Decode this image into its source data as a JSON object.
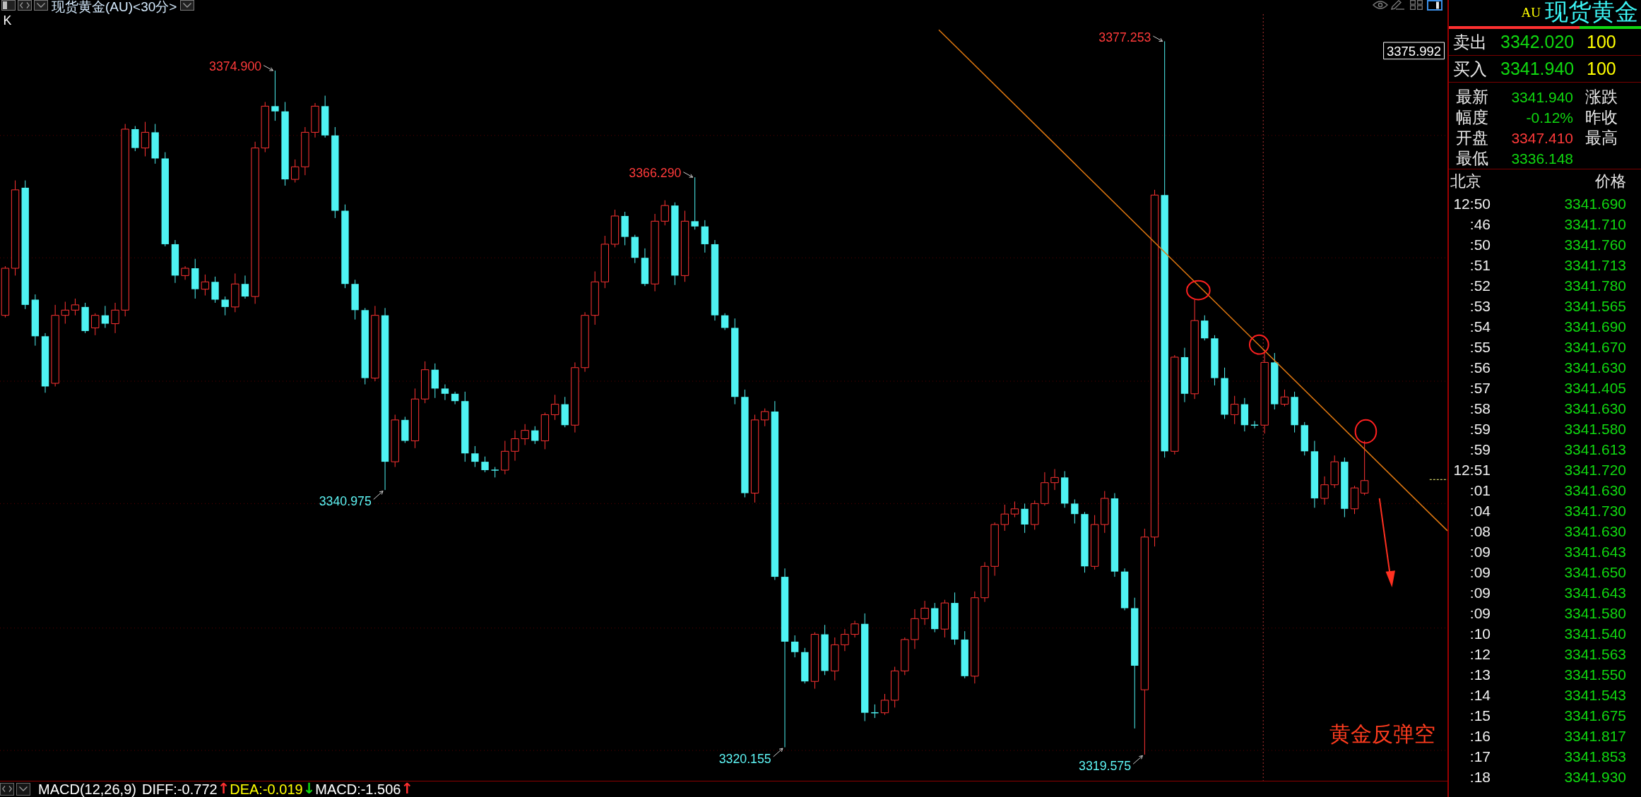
{
  "toolbar": {
    "title": "现货黄金(AU)<30分>"
  },
  "chart": {
    "label": "K",
    "price_tag": "3375.992",
    "annotations": [
      {
        "kind": "high",
        "text": "3377.253"
      },
      {
        "kind": "high",
        "text": "3374.900"
      },
      {
        "kind": "high",
        "text": "3366.290"
      },
      {
        "kind": "low",
        "text": "3340.975"
      },
      {
        "kind": "low",
        "text": "3320.155"
      },
      {
        "kind": "low",
        "text": "3319.575"
      }
    ],
    "note": "黄金反弹空"
  },
  "indicator_bar": {
    "name": "MACD(12,26,9)",
    "values": [
      {
        "label": "DIFF:-0.772",
        "color": "#ffffff",
        "arrow": {
          "text": "↑",
          "color": "#ff3030"
        }
      },
      {
        "label": "DEA:-0.019",
        "color": "#ffff00",
        "arrow": {
          "text": "↓",
          "color": "#10d810"
        }
      },
      {
        "label": "MACD:-1.506",
        "color": "#ffffff",
        "arrow": {
          "text": "↑",
          "color": "#ff3030"
        }
      }
    ]
  },
  "quote_panel": {
    "symbol": "AU",
    "title": "现货黄金",
    "ratio_bar": {
      "level": 0.68
    },
    "order_book": [
      {
        "label": "卖出",
        "price": "3342.020",
        "volume": "100"
      },
      {
        "label": "买入",
        "price": "3341.940",
        "volume": "100"
      }
    ],
    "quotes": [
      {
        "label": "最新",
        "value": "3341.940",
        "color": "#10d810",
        "label_2": "涨跌"
      },
      {
        "label": "幅度",
        "value": "-0.12%",
        "color": "#10d810",
        "label_2": "昨收"
      },
      {
        "label": "开盘",
        "value": "3347.410",
        "color": "#ff3a3a",
        "label_2": "最高"
      },
      {
        "label": "最低",
        "value": "3336.148",
        "color": "#10d810"
      }
    ],
    "ticks": {
      "columns": [
        "北京",
        "价格"
      ],
      "rows": [
        {
          "time": "12:50",
          "price": "3341.690"
        },
        {
          "time": ":46",
          "price": "3341.710"
        },
        {
          "time": ":50",
          "price": "3341.760"
        },
        {
          "time": ":51",
          "price": "3341.713"
        },
        {
          "time": ":52",
          "price": "3341.780"
        },
        {
          "time": ":53",
          "price": "3341.565"
        },
        {
          "time": ":54",
          "price": "3341.690"
        },
        {
          "time": ":55",
          "price": "3341.670"
        },
        {
          "time": ":56",
          "price": "3341.630"
        },
        {
          "time": ":57",
          "price": "3341.405"
        },
        {
          "time": ":58",
          "price": "3341.630"
        },
        {
          "time": ":59",
          "price": "3341.580"
        },
        {
          "time": ":59",
          "price": "3341.613"
        },
        {
          "time": "12:51",
          "price": "3341.720"
        },
        {
          "time": ":01",
          "price": "3341.630"
        },
        {
          "time": ":04",
          "price": "3341.730"
        },
        {
          "time": ":08",
          "price": "3341.630"
        },
        {
          "time": ":09",
          "price": "3341.643"
        },
        {
          "time": ":09",
          "price": "3341.650"
        },
        {
          "time": ":09",
          "price": "3341.643"
        },
        {
          "time": ":09",
          "price": "3341.580"
        },
        {
          "time": ":10",
          "price": "3341.540"
        },
        {
          "time": ":12",
          "price": "3341.563"
        },
        {
          "time": ":13",
          "price": "3341.550"
        },
        {
          "time": ":14",
          "price": "3341.543"
        },
        {
          "time": ":15",
          "price": "3341.675"
        },
        {
          "time": ":16",
          "price": "3341.817"
        },
        {
          "time": ":17",
          "price": "3341.853"
        },
        {
          "time": ":18",
          "price": "3341.930"
        }
      ]
    }
  }
}
